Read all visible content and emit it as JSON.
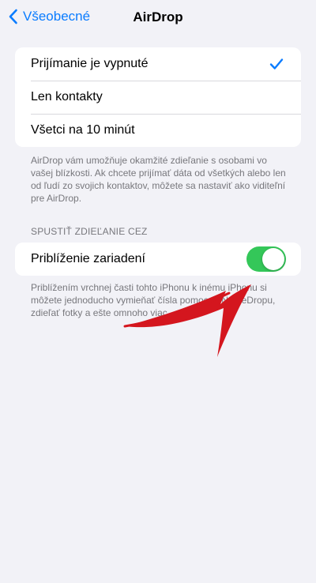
{
  "nav": {
    "back_label": "Všeobecné",
    "title": "AirDrop"
  },
  "receive_options": [
    {
      "label": "Prijímanie je vypnuté",
      "selected": true
    },
    {
      "label": "Len kontakty",
      "selected": false
    },
    {
      "label": "Všetci na 10 minút",
      "selected": false
    }
  ],
  "airdrop_footnote": "AirDrop vám umožňuje okamžité zdieľanie s osobami vo vašej blízkosti. Ak chcete prijímať dáta od všetkých alebo len od ľudí zo svojich kontaktov, môžete sa nastaviť ako viditeľní pre AirDrop.",
  "share_section": {
    "header": "SPUSTIŤ ZDIEĽANIE CEZ",
    "toggle_label": "Priblíženie zariadení",
    "toggle_on": true,
    "footnote": "Priblížením vrchnej časti tohto iPhonu k inému iPhonu si môžete jednoducho vymieňať čísla pomocou NameDropu, zdieľať fotky a ešte omnoho viac."
  },
  "colors": {
    "accent": "#0a7cff",
    "toggle_on": "#34c759",
    "annotation_arrow": "#d4161e",
    "background": "#f2f2f7"
  },
  "icons": {
    "back": "chevron-left-icon",
    "check": "checkmark-icon",
    "annotation": "red-arrow-annotation"
  }
}
